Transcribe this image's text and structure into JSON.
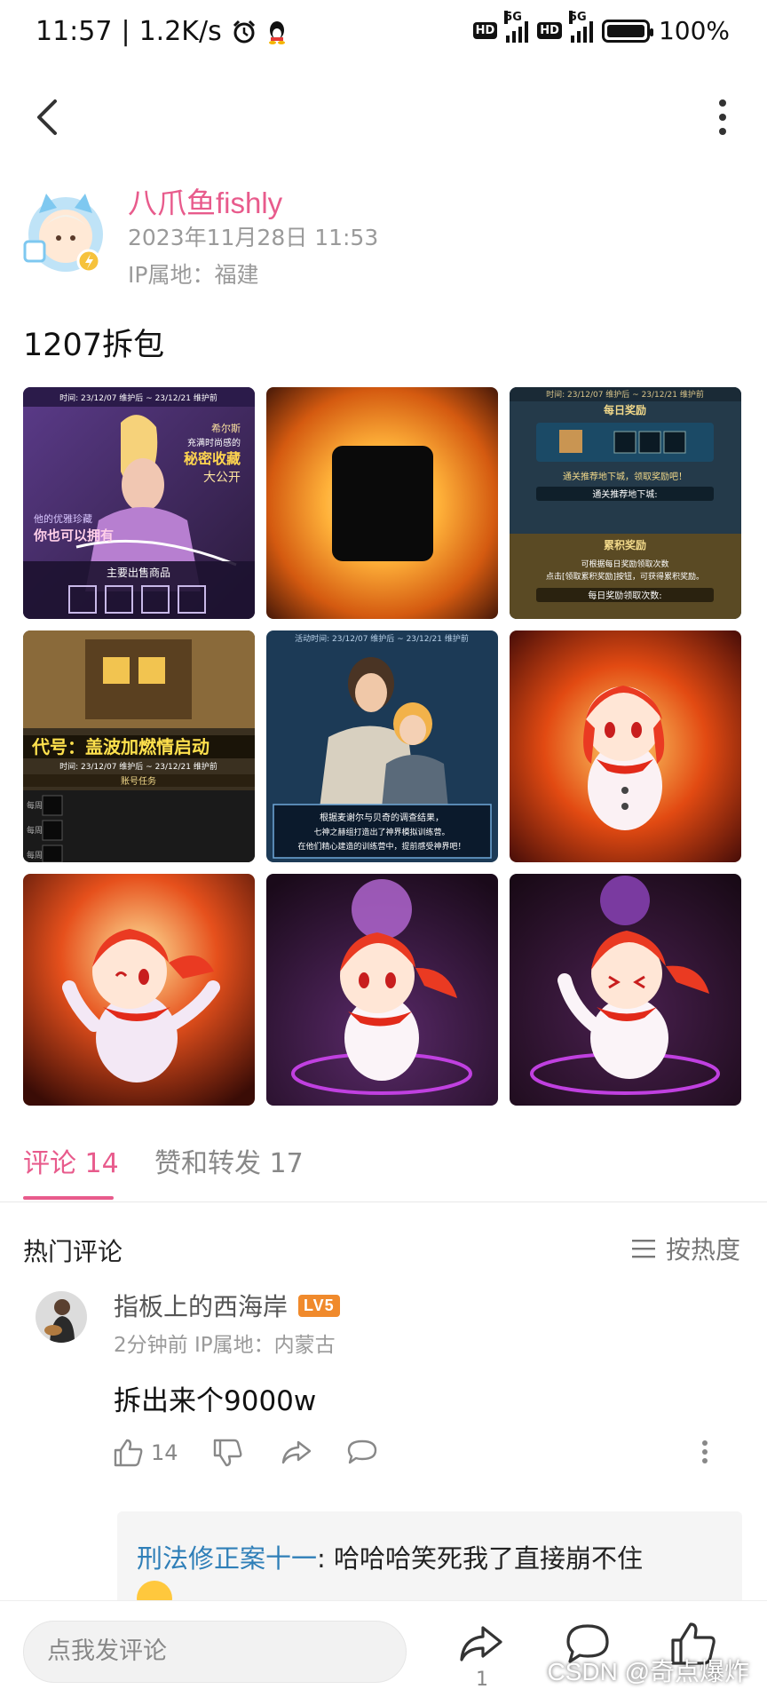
{
  "status_bar": {
    "time": "11:57",
    "speed": "1.2K/s",
    "network1": "5G",
    "network2": "5G",
    "battery": "100%"
  },
  "post": {
    "author": "八爪鱼fishly",
    "datetime": "2023年11月28日 11:53",
    "ip": "IP属地：福建",
    "text": "1207拆包"
  },
  "tabs": {
    "comments": "评论 14",
    "likes_reposts": "赞和转发 17"
  },
  "comments_section": {
    "title": "热门评论",
    "sort": "按热度"
  },
  "comment": {
    "user": "指板上的西海岸",
    "level": "LV5",
    "meta": "2分钟前  IP属地：内蒙古",
    "text": "拆出来个9000w",
    "likes": "14"
  },
  "reply": {
    "user": "刑法修正案十一",
    "text": ": 哈哈哈笑死我了直接崩不住"
  },
  "bottom": {
    "input_placeholder": "点我发评论",
    "share_count": "1",
    "watermark": "CSDN @奇点爆炸"
  },
  "images": {
    "img1": {
      "line1": "时间: 23/12/07 维护后 ~ 23/12/21 维护前",
      "line2": "希尔斯",
      "line3": "充满时尚感的",
      "line4": "秘密收藏",
      "line5": "大公开",
      "line6": "他的优雅珍藏",
      "line7": "你也可以拥有",
      "line8": "主要出售商品"
    },
    "img3": {
      "line1": "时间: 23/12/07 维护后 ~ 23/12/21 维护前",
      "line2": "每日奖励",
      "line3": "通关推荐地下城，领取奖励吧！",
      "line4": "通关推荐地下城:",
      "line5": "累积奖励",
      "line6": "可根据每日奖励领取次数",
      "line7": "点击[领取累积奖励]按钮，可获得累积奖励。",
      "line8": "每日奖励领取次数:"
    },
    "img4": {
      "line1": "代号：盖波加燃情启动",
      "line2": "时间: 23/12/07 维护后 ~ 23/12/21 维护前",
      "line3": "账号任务",
      "row": "每周"
    },
    "img5": {
      "line1": "活动时间: 23/12/07 维护后 ~ 23/12/21 维护前",
      "line2": "根据麦谢尔与贝奇的调查结果，",
      "line3": "七神之赫组打造出了神界模拟训练营。",
      "line4": "在他们精心建造的训练营中，提前感受神界吧！"
    }
  },
  "colors": {
    "accent": "#e85b8c",
    "reply_user": "#2f7fb8",
    "level_badge": "#f08a2c"
  }
}
